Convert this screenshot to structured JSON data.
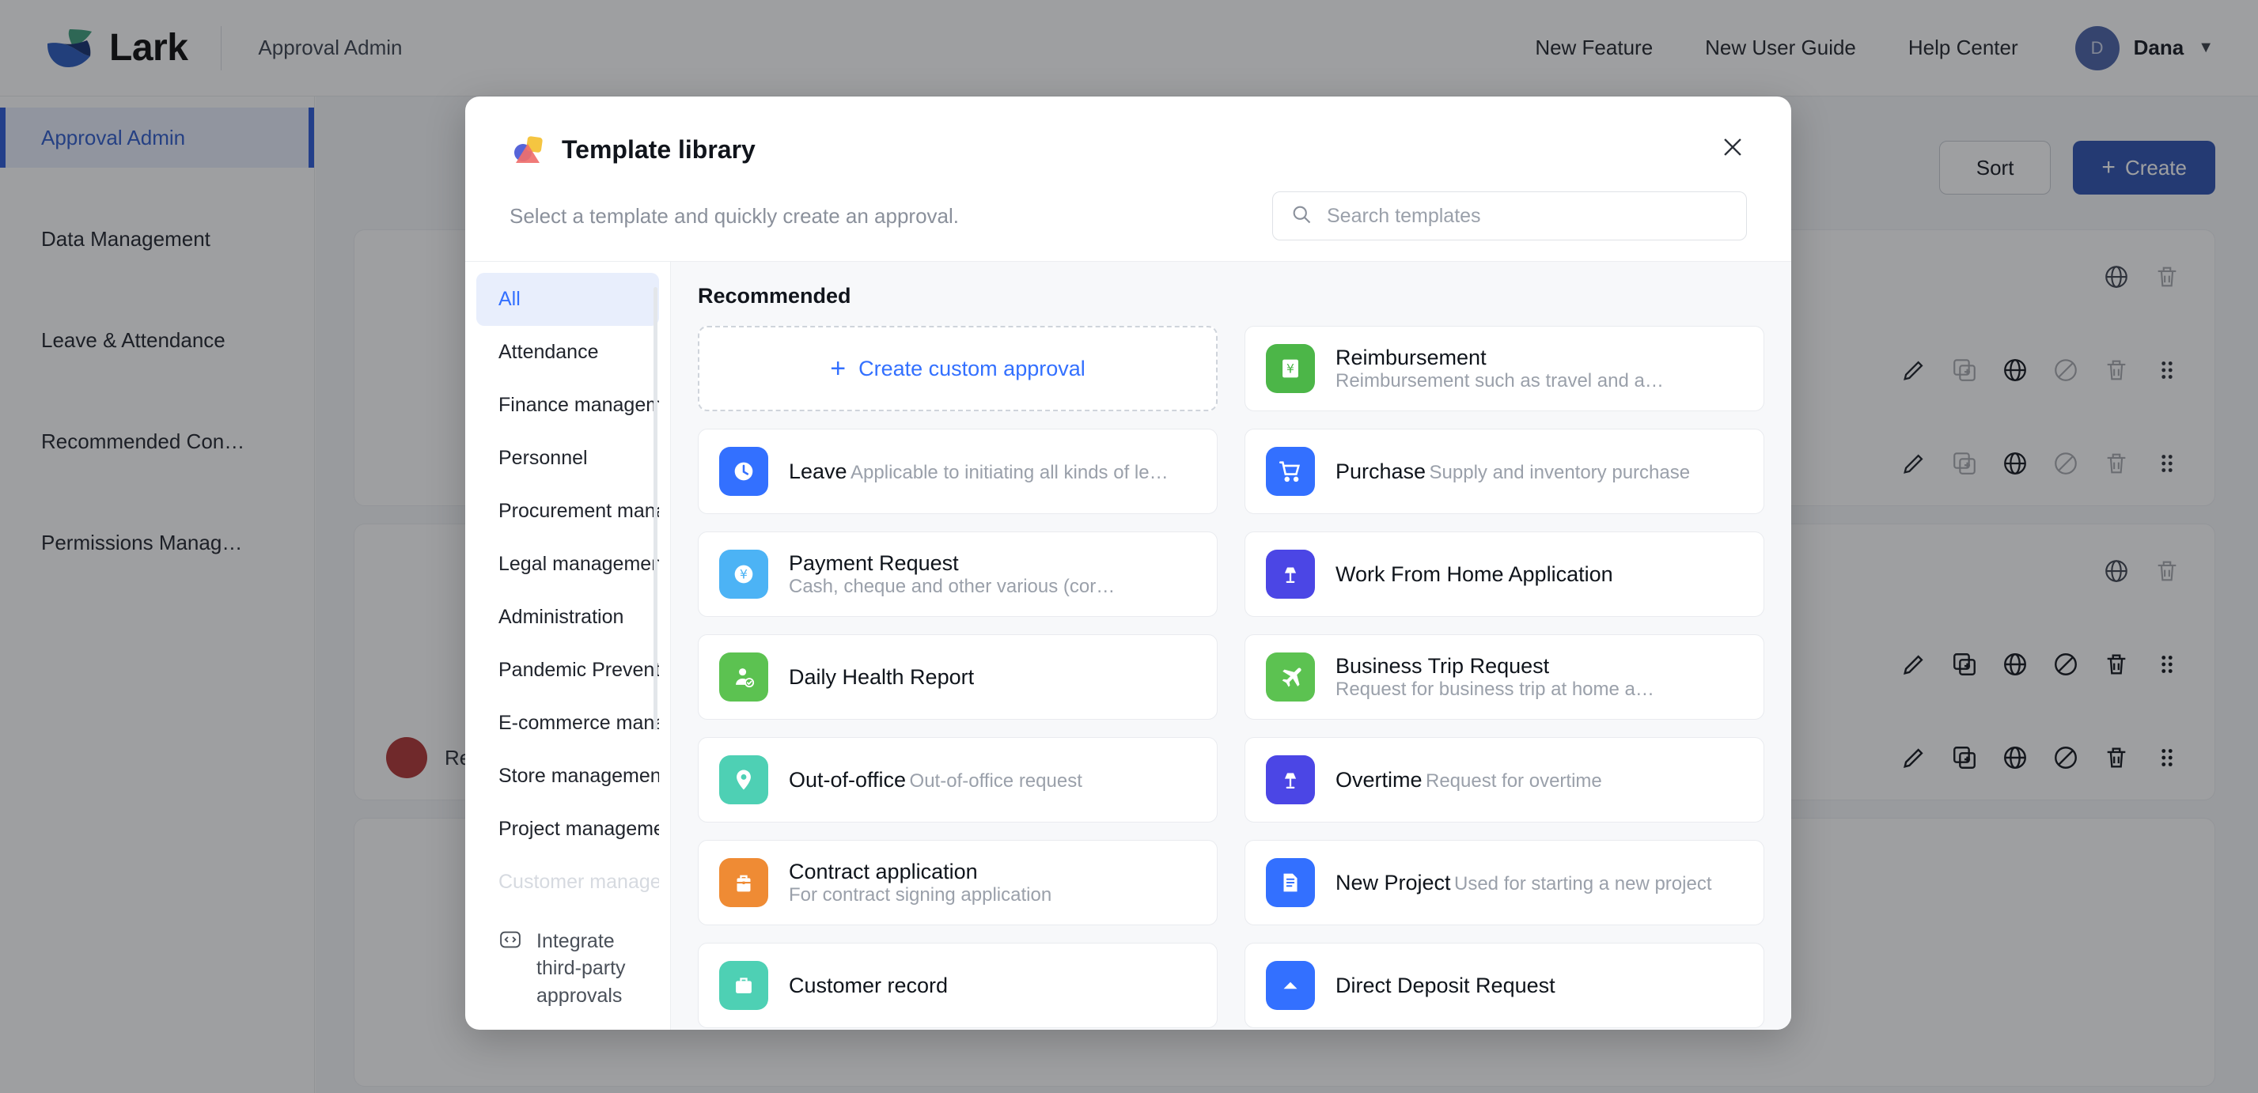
{
  "topbar": {
    "brand_name": "Lark",
    "section_label": "Approval Admin",
    "nav": [
      {
        "label": "New Feature"
      },
      {
        "label": "New User Guide"
      },
      {
        "label": "Help Center"
      }
    ],
    "user": {
      "initial": "D",
      "name": "Dana",
      "caret": "▼"
    }
  },
  "sidebar": {
    "items": [
      {
        "label": "Approval Admin",
        "active": true
      },
      {
        "label": "Data Management",
        "active": false
      },
      {
        "label": "Leave & Attendance",
        "active": false
      },
      {
        "label": "Recommended Con…",
        "active": false
      },
      {
        "label": "Permissions Manag…",
        "active": false
      }
    ]
  },
  "content": {
    "sort_label": "Sort",
    "create_label": "Create",
    "create_plus": "+",
    "hidden_item_label": "Resignation request"
  },
  "modal": {
    "title": "Template library",
    "subtitle": "Select a template and quickly create an approval.",
    "close_label": "✕",
    "search": {
      "placeholder": "Search templates"
    },
    "categories": [
      {
        "label": "All",
        "active": true
      },
      {
        "label": "Attendance",
        "active": false
      },
      {
        "label": "Finance management",
        "active": false
      },
      {
        "label": "Personnel",
        "active": false
      },
      {
        "label": "Procurement managem…",
        "active": false
      },
      {
        "label": "Legal management",
        "active": false
      },
      {
        "label": "Administration",
        "active": false
      },
      {
        "label": "Pandemic Prevention",
        "active": false
      },
      {
        "label": "E-commerce manage…",
        "active": false
      },
      {
        "label": "Store management",
        "active": false
      },
      {
        "label": "Project management",
        "active": false
      },
      {
        "label": "Customer management",
        "active": false,
        "faded": true
      }
    ],
    "integrate_label": "Integrate third-party approvals",
    "section_title": "Recommended",
    "create_custom_label": "Create custom approval",
    "create_custom_plus": "+",
    "templates": [
      {
        "name": "Reimbursement",
        "desc": "Reimbursement such as travel and a…",
        "icon": "yen-card-icon",
        "color": "#4cb648"
      },
      {
        "name": "Leave",
        "desc": "Applicable to initiating all kinds of le…",
        "icon": "clock-icon",
        "color": "#3370ff"
      },
      {
        "name": "Purchase",
        "desc": "Supply and inventory purchase",
        "icon": "cart-icon",
        "color": "#3370ff"
      },
      {
        "name": "Payment Request",
        "desc": "Cash, cheque and other various (cor…",
        "icon": "yen-circle-icon",
        "color": "#4cb3f5"
      },
      {
        "name": "Work From Home Application",
        "desc": "",
        "icon": "lamp-icon",
        "color": "#4b46e5"
      },
      {
        "name": "Daily Health Report",
        "desc": "",
        "icon": "person-check-icon",
        "color": "#5cc251"
      },
      {
        "name": "Business Trip Request",
        "desc": "Request for business trip at home a…",
        "icon": "plane-icon",
        "color": "#5cc251"
      },
      {
        "name": "Out-of-office",
        "desc": "Out-of-office request",
        "icon": "pin-icon",
        "color": "#4ed0b4"
      },
      {
        "name": "Overtime",
        "desc": "Request for overtime",
        "icon": "lamp-icon",
        "color": "#4b46e5"
      },
      {
        "name": "Contract application",
        "desc": "For contract signing application",
        "icon": "briefcase-icon",
        "color": "#ef8b34"
      },
      {
        "name": "New Project",
        "desc": "Used for starting a new project",
        "icon": "document-icon",
        "color": "#3370ff"
      },
      {
        "name": "Customer record",
        "desc": "",
        "icon": "medical-icon",
        "color": "#4ed0b4"
      },
      {
        "name": "Direct Deposit Request",
        "desc": "",
        "icon": "bank-icon",
        "color": "#3370ff"
      }
    ]
  },
  "colors": {
    "accent": "#3370ff",
    "primary_button": "#2d52b0",
    "sidebar_active_bg": "#e8eefc",
    "overlay": "rgba(23,26,31,0.42)"
  }
}
